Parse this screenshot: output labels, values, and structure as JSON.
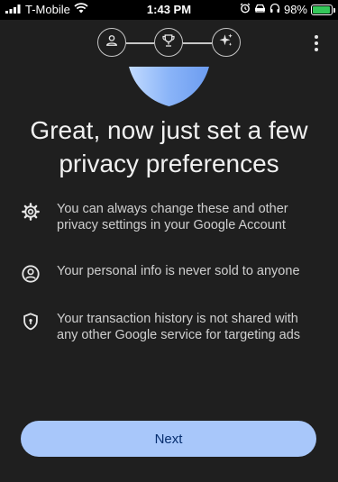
{
  "status_bar": {
    "carrier": "T-Mobile",
    "time": "1:43 PM",
    "battery_percent": "98%",
    "battery_level": 0.98
  },
  "stepper": {
    "steps": [
      {
        "icon": "person-icon",
        "state": "done"
      },
      {
        "icon": "trophy-icon",
        "state": "current"
      },
      {
        "icon": "sparkle-icon",
        "state": "upcoming"
      }
    ]
  },
  "page": {
    "title": "Great, now just set a few privacy preferences",
    "features": [
      {
        "icon": "gear-icon",
        "text": "You can always change these and other privacy settings in your Google Account"
      },
      {
        "icon": "account-circle-icon",
        "text": "Your personal info is never sold to anyone"
      },
      {
        "icon": "shield-lock-icon",
        "text": "Your transaction history is not shared with any other Google service for targeting ads"
      }
    ],
    "next_label": "Next"
  },
  "colors": {
    "background": "#1f1f1f",
    "accent": "#a8c7fa",
    "accent_text": "#062e6f",
    "illustration": "#8ab4f8"
  }
}
